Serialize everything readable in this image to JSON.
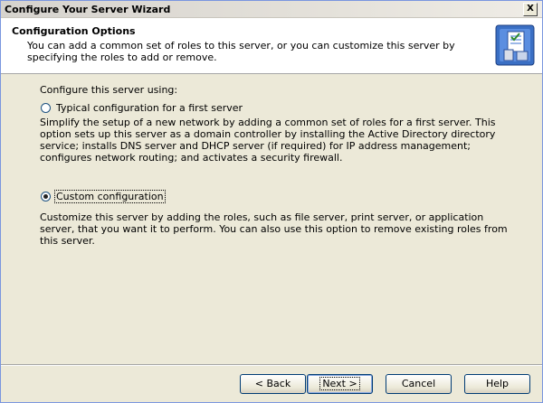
{
  "window": {
    "title": "Configure Your Server Wizard",
    "close_glyph": "X"
  },
  "header": {
    "title": "Configuration Options",
    "subtitle": "You can add a common set of roles to this server, or you can customize this server by specifying the roles to add or remove.",
    "icon": "server-configuration-icon"
  },
  "content": {
    "prompt": "Configure this server using:",
    "options": [
      {
        "label": "Typical configuration for a first server",
        "selected": false,
        "description": "Simplify the setup of a new network by adding a common set of roles for a first server. This option sets up this server as a domain controller by installing the Active Directory directory service; installs DNS server and DHCP server (if required) for IP address management; configures network routing; and activates a security firewall."
      },
      {
        "label": "Custom configuration",
        "selected": true,
        "description": "Customize this server by adding the roles, such as file server, print server, or application server, that you want it to perform. You can also use this option to remove existing roles from this server."
      }
    ]
  },
  "footer": {
    "back_label": "< Back",
    "next_label": "Next >",
    "cancel_label": "Cancel",
    "help_label": "Help"
  }
}
